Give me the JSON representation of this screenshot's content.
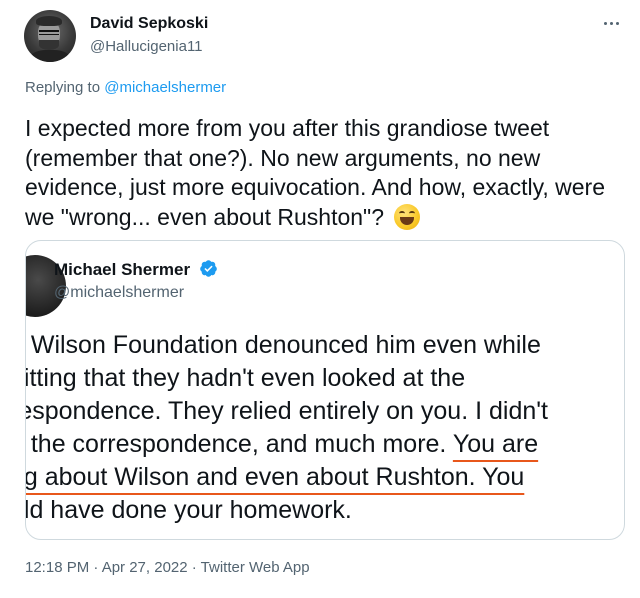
{
  "tweet": {
    "author_name": "David Sepkoski",
    "author_handle": "@Hallucigenia11",
    "reply_prefix": "Replying to",
    "reply_mention": "@michaelshermer",
    "text": "I expected more from you after this grandiose tweet (remember that one?). No new arguments, no new evidence, just more equivocation. And how, exactly, were we \"wrong... even about Rushton\"?",
    "emoji": "grinning-squinting-face",
    "timestamp": "12:18 PM · Apr 27, 2022 · Twitter Web App"
  },
  "quote": {
    "author_name": "Michael Shermer",
    "author_handle": "@michaelshermer",
    "verified": true,
    "lines": [
      {
        "plain": "e Wilson Foundation denounced him even while",
        "highlight": ""
      },
      {
        "plain": "nitting that they hadn't even looked at the",
        "highlight": ""
      },
      {
        "plain": "respondence. They relied entirely on you. I didn't",
        "highlight": ""
      },
      {
        "plain": "d the correspondence, and much more. ",
        "highlight": "You are"
      },
      {
        "plain": "",
        "highlight": "ng about Wilson and even about Rushton. You"
      },
      {
        "plain": "uld have done your homework.",
        "highlight": ""
      }
    ]
  },
  "colors": {
    "link": "#1d9bf0",
    "secondary_text": "#536471",
    "underline": "#e8571b",
    "border": "#cfd9de",
    "verified": "#1d9bf0"
  }
}
